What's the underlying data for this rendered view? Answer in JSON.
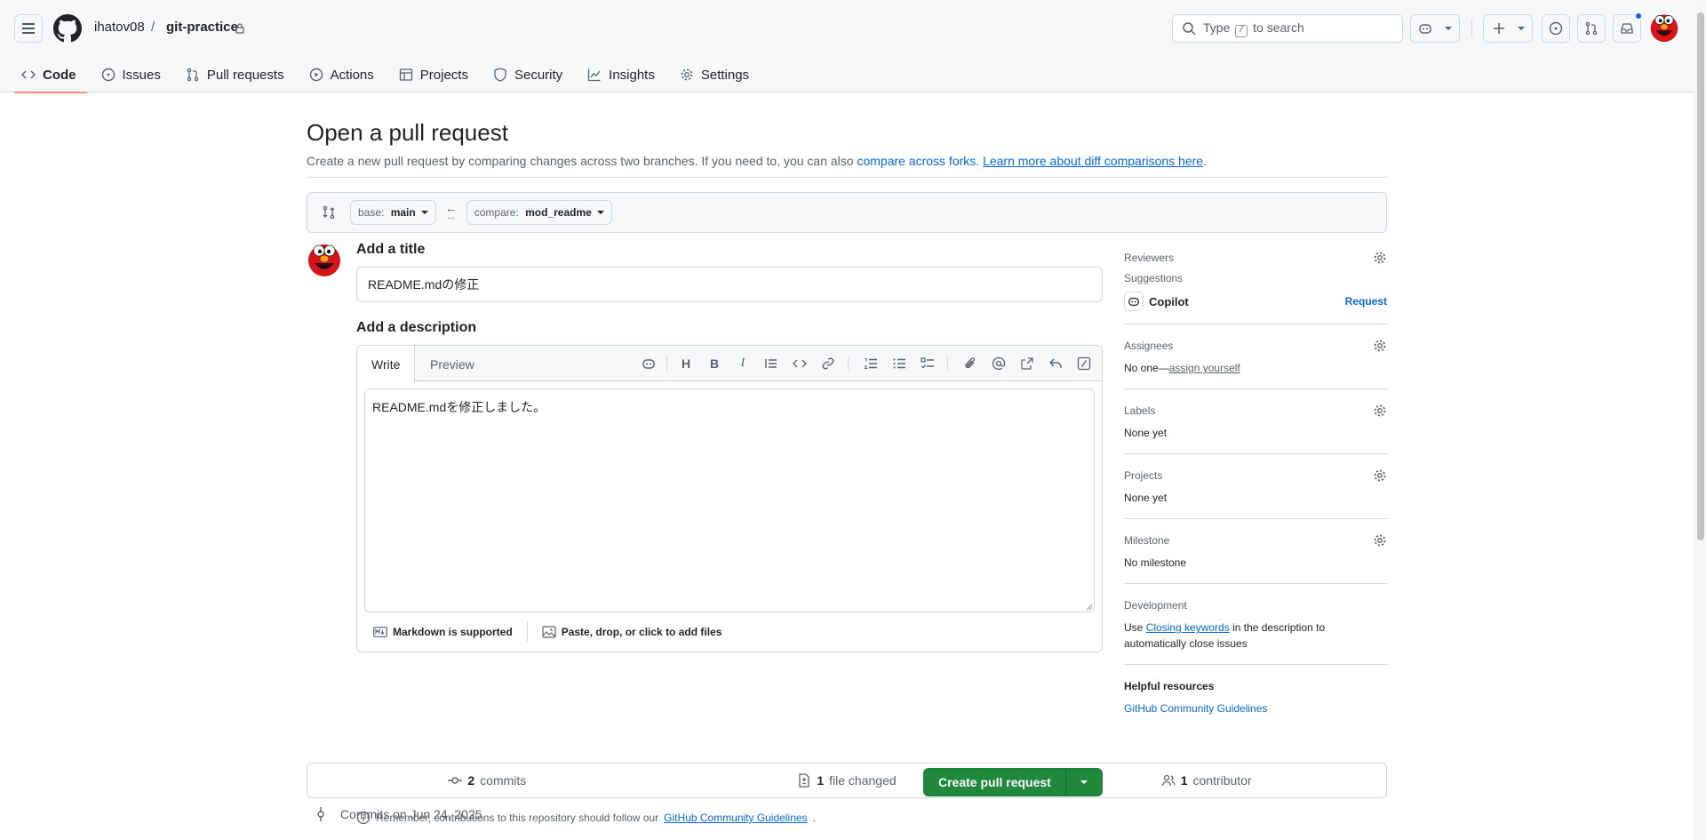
{
  "header": {
    "owner": "ihatov08",
    "separator": "/",
    "repo": "git-practice",
    "search_prefix": "Type",
    "search_key": "/",
    "search_suffix": "to search"
  },
  "tabs": [
    {
      "label": "Code",
      "icon": "code-icon"
    },
    {
      "label": "Issues",
      "icon": "issue-icon"
    },
    {
      "label": "Pull requests",
      "icon": "pull-request-icon"
    },
    {
      "label": "Actions",
      "icon": "play-icon"
    },
    {
      "label": "Projects",
      "icon": "table-icon"
    },
    {
      "label": "Security",
      "icon": "shield-icon"
    },
    {
      "label": "Insights",
      "icon": "graph-icon"
    },
    {
      "label": "Settings",
      "icon": "gear-icon"
    }
  ],
  "page": {
    "title": "Open a pull request",
    "subtitle_text": "Create a new pull request by comparing changes across two branches. If you need to, you can also ",
    "compare_forks_link": "compare across forks",
    "learn_more_link": "Learn more about diff comparisons here",
    "period": "."
  },
  "compare": {
    "base_prefix": "base:",
    "base_branch": "main",
    "arrow": "←",
    "dots": "...",
    "compare_prefix": "compare:",
    "compare_branch": "mod_readme"
  },
  "form": {
    "title_label": "Add a title",
    "title_value": "README.mdの修正",
    "description_label": "Add a description",
    "write_tab": "Write",
    "preview_tab": "Preview",
    "body_value": "README.mdを修正しました。",
    "markdown_hint": "Markdown is supported",
    "files_hint": "Paste, drop, or click to add files",
    "submit_label": "Create pull request",
    "remember_text": "Remember, contributions to this repository should follow our",
    "guidelines_link": "GitHub Community Guidelines",
    "period": "."
  },
  "toolbar": {
    "heading": "H",
    "bold": "B",
    "italic": "I"
  },
  "sidebar": {
    "reviewers": {
      "title": "Reviewers",
      "suggestions": "Suggestions",
      "suggested_name": "Copilot",
      "request": "Request"
    },
    "assignees": {
      "title": "Assignees",
      "none": "No one—",
      "assign_link": "assign yourself"
    },
    "labels": {
      "title": "Labels",
      "value": "None yet"
    },
    "projects": {
      "title": "Projects",
      "value": "None yet"
    },
    "milestone": {
      "title": "Milestone",
      "value": "No milestone"
    },
    "development": {
      "title": "Development",
      "use": "Use ",
      "keywords_link": "Closing keywords",
      "rest": " in the description to automatically close issues"
    },
    "helpful": {
      "title": "Helpful resources",
      "link": "GitHub Community Guidelines"
    }
  },
  "stats": {
    "commits_count": "2",
    "commits_label": "commits",
    "files_count": "1",
    "files_label": "file changed",
    "contributors_count": "1",
    "contributors_label": "contributor"
  },
  "commits_on": "Commits on Jun 24, 2025",
  "colors": {
    "accent": "#0969da",
    "primary_button": "#1f883d",
    "tab_underline": "#fd8c73",
    "notification_dot": "#0969da"
  }
}
